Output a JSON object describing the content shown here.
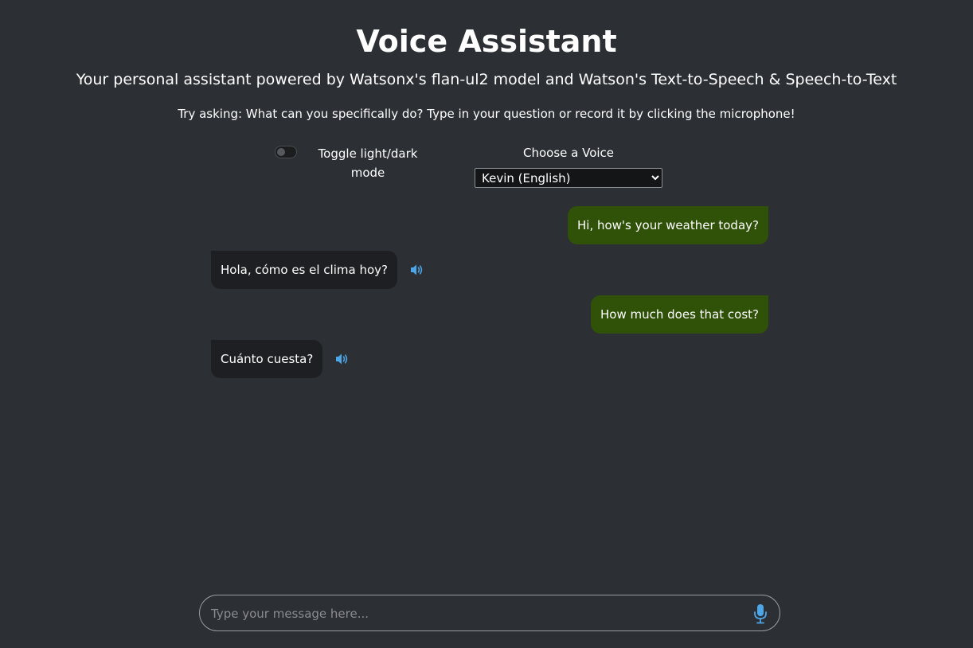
{
  "header": {
    "title": "Voice Assistant",
    "subtitle": "Your personal assistant powered by Watsonx's flan-ul2 model and Watson's Text-to-Speech & Speech-to-Text",
    "hint": "Try asking: What can you specifically do? Type in your question or record it by clicking the microphone!"
  },
  "controls": {
    "toggle_label": "Toggle light/dark mode",
    "toggle_on": false,
    "voice_label": "Choose a Voice",
    "voice_selected": "Kevin (English)"
  },
  "messages": [
    {
      "role": "user",
      "text": "Hi, how's your weather today?"
    },
    {
      "role": "bot",
      "text": "Hola, cómo es el clima hoy?"
    },
    {
      "role": "user",
      "text": "How much does that cost?"
    },
    {
      "role": "bot",
      "text": "Cuánto cuesta?"
    }
  ],
  "input": {
    "placeholder": "Type your message here...",
    "value": ""
  },
  "icons": {
    "speaker": "speaker-icon",
    "microphone": "microphone-icon"
  },
  "colors": {
    "background": "#2c2f33",
    "user_bubble": "#2f5108",
    "bot_bubble": "#1d1f22",
    "accent": "#4da6e8"
  }
}
